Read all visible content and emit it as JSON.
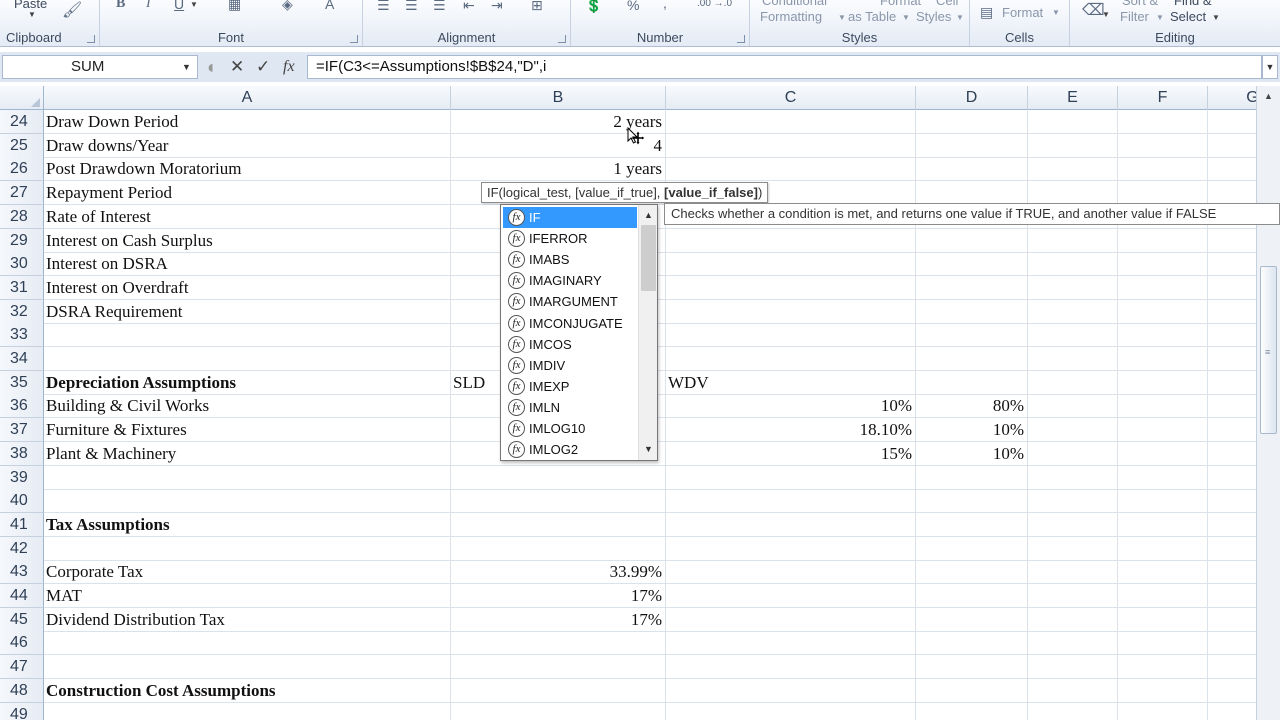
{
  "ribbon": {
    "clipboard": {
      "label": "Clipboard",
      "paste": "Paste"
    },
    "font": {
      "label": "Font",
      "bold": "B",
      "italic": "I",
      "underline": "U",
      "font_color": "A"
    },
    "alignment": {
      "label": "Alignment"
    },
    "number": {
      "label": "Number",
      "percent": "%",
      "comma": ",",
      "inc_decimal": ".00 →.0",
      "dec_decimal": ".00"
    },
    "styles": {
      "label": "Styles",
      "conditional_1": "Conditional",
      "conditional_2": "Formatting",
      "table_1": "Format",
      "table_2": "as Table",
      "cell_1": "Cell",
      "cell_2": "Styles"
    },
    "cells": {
      "label": "Cells",
      "format": "Format"
    },
    "editing": {
      "label": "Editing",
      "sort_1": "Sort &",
      "sort_2": "Filter",
      "find_1": "Find &",
      "find_2": "Select"
    }
  },
  "formula_bar": {
    "name_box": "SUM",
    "cancel": "✕",
    "enter": "✓",
    "fx": "fx",
    "formula": "=IF(C3<=Assumptions!$B$24,\"D\",i"
  },
  "columns": [
    "A",
    "B",
    "C",
    "D",
    "E",
    "F",
    "G"
  ],
  "rows": [
    {
      "num": "24",
      "a": "Draw Down Period",
      "b": "2 years"
    },
    {
      "num": "25",
      "a": "Draw downs/Year",
      "b": "4"
    },
    {
      "num": "26",
      "a": "Post Drawdown Moratorium",
      "b": "1 years"
    },
    {
      "num": "27",
      "a": "Repayment Period",
      "b": ""
    },
    {
      "num": "28",
      "a": "Rate of Interest",
      "b": ""
    },
    {
      "num": "29",
      "a": "Interest on Cash Surplus",
      "b": ""
    },
    {
      "num": "30",
      "a": "Interest on DSRA",
      "b": ""
    },
    {
      "num": "31",
      "a": "Interest on Overdraft",
      "b": ""
    },
    {
      "num": "32",
      "a": "DSRA Requirement",
      "b": ""
    },
    {
      "num": "33",
      "a": "",
      "b": ""
    },
    {
      "num": "34",
      "a": "",
      "b": ""
    },
    {
      "num": "35",
      "a": "Depreciation Assumptions",
      "bold": true,
      "b_left": "SLD",
      "c_left": "WDV"
    },
    {
      "num": "36",
      "a": "Building & Civil Works",
      "c": "10%",
      "d": "80%"
    },
    {
      "num": "37",
      "a": "Furniture & Fixtures",
      "c": "18.10%",
      "d": "10%"
    },
    {
      "num": "38",
      "a": "Plant & Machinery",
      "c": "15%",
      "d": "10%"
    },
    {
      "num": "39",
      "a": ""
    },
    {
      "num": "40",
      "a": ""
    },
    {
      "num": "41",
      "a": "Tax Assumptions",
      "bold": true
    },
    {
      "num": "42",
      "a": ""
    },
    {
      "num": "43",
      "a": "Corporate Tax",
      "b": "33.99%"
    },
    {
      "num": "44",
      "a": "MAT",
      "b": "17%"
    },
    {
      "num": "45",
      "a": "Dividend Distribution Tax",
      "b": "17%"
    },
    {
      "num": "46",
      "a": ""
    },
    {
      "num": "47",
      "a": ""
    },
    {
      "num": "48",
      "a": "Construction Cost Assumptions",
      "bold": true
    },
    {
      "num": "49",
      "a": ""
    }
  ],
  "syntax_tip": {
    "fn": "IF(logical_test, [value_if_true], ",
    "current": "[value_if_false]",
    "close": ")"
  },
  "description_tip": "Checks whether a condition is met, and returns one value if TRUE, and another value if FALSE",
  "autocomplete": {
    "items": [
      "IF",
      "IFERROR",
      "IMABS",
      "IMAGINARY",
      "IMARGUMENT",
      "IMCONJUGATE",
      "IMCOS",
      "IMDIV",
      "IMEXP",
      "IMLN",
      "IMLOG10",
      "IMLOG2"
    ],
    "selected": 0,
    "fx_glyph": "fx"
  }
}
